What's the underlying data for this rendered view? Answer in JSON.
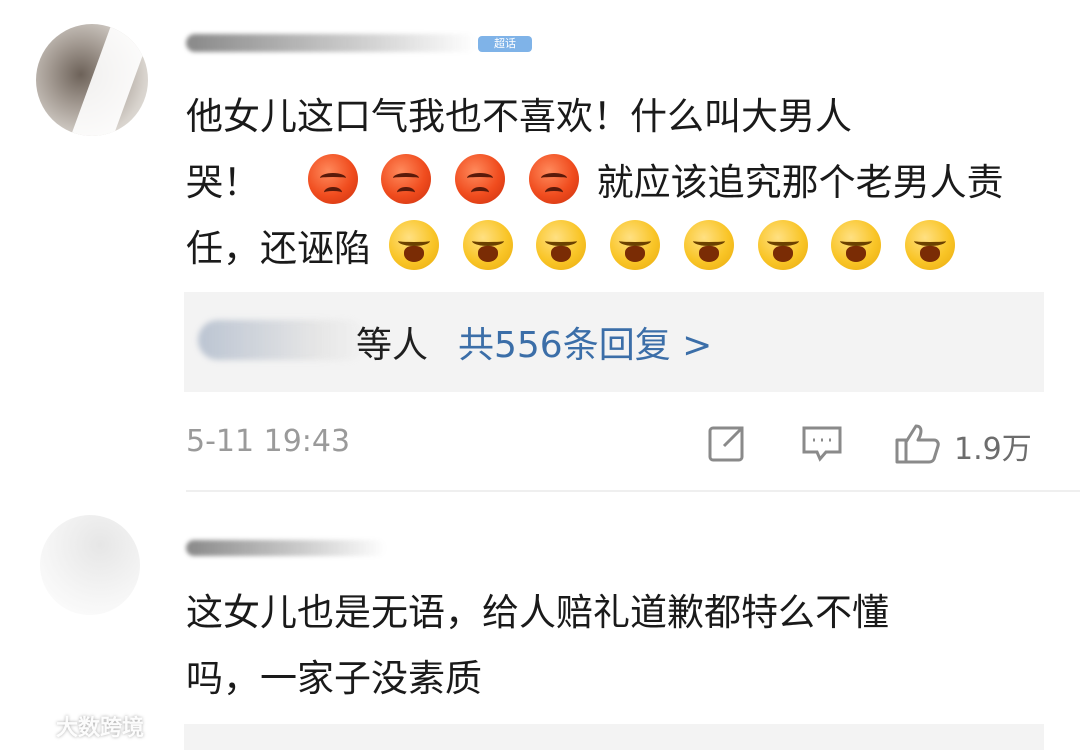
{
  "comments": [
    {
      "badge": "超话",
      "text_line1": "他女儿这口气我也不喜欢！什么叫大男人",
      "text_line2a": "哭！",
      "text_line2b": "就应该追究那个老男人责",
      "text_line3": "任，还诬陷",
      "emojis_angry": [
        "angry-emoji",
        "angry-emoji",
        "angry-emoji",
        "angry-emoji"
      ],
      "emojis_shout": [
        "shout-emoji",
        "shout-emoji",
        "shout-emoji",
        "shout-emoji",
        "shout-emoji",
        "shout-emoji",
        "shout-emoji",
        "shout-emoji"
      ],
      "replies": {
        "users_suffix": "等人",
        "link": "共556条回复 >"
      },
      "timestamp": "5-11 19:43",
      "like_count": "1.9万"
    },
    {
      "text_line1": "这女儿也是无语，给人赔礼道歉都特么不懂",
      "text_line2": "吗，一家子没素质"
    }
  ],
  "icons": {
    "share": "share-icon",
    "comment": "comment-icon",
    "like": "thumbs-up-icon"
  },
  "watermark": {
    "text": "大数跨境"
  },
  "colors": {
    "link": "#3b6ea8",
    "meta": "#9a9a9a",
    "reply_bg": "#f3f3f3",
    "angry_emoji": "#f04c1e",
    "shout_emoji": "#f9c527"
  }
}
